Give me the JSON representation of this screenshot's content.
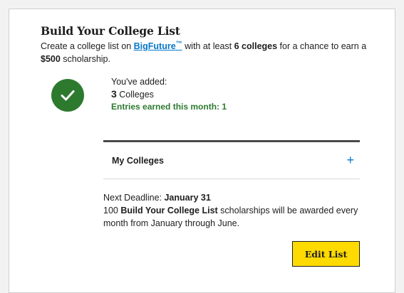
{
  "card": {
    "title": "Build Your College List",
    "description": {
      "prefix": "Create a college list on ",
      "link_text": "BigFuture",
      "trademark": "™",
      "middle": " with at least ",
      "min_colleges": "6 colleges",
      "suffix": " for a chance to earn a ",
      "amount": "$500",
      "end": " scholarship."
    }
  },
  "status": {
    "icon": "check-icon",
    "added_label": "You've added:",
    "count": "3",
    "count_unit": " Colleges",
    "entries": "Entries earned this month: 1"
  },
  "my_colleges": {
    "label": "My Colleges",
    "toggle_icon": "+"
  },
  "deadline": {
    "label": "Next Deadline: ",
    "date": "January 31",
    "line_prefix": "100 ",
    "program": "Build Your College List",
    "line_suffix": " scholarships will be awarded every month from January through June."
  },
  "actions": {
    "edit_label": "Edit List"
  },
  "colors": {
    "accent_green": "#2d7a2f",
    "link_blue": "#0677ca",
    "button_yellow": "#fedb00"
  }
}
